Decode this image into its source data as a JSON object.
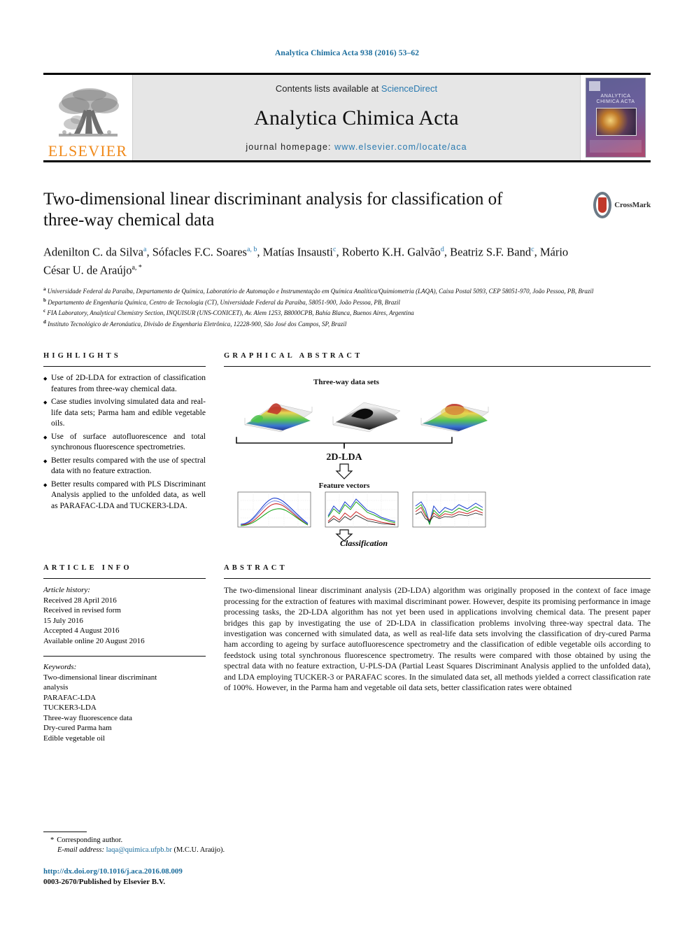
{
  "running_head": "Analytica Chimica Acta 938 (2016) 53–62",
  "masthead": {
    "publisher_name": "ELSEVIER",
    "contents_prefix": "Contents lists available at ",
    "contents_link": "ScienceDirect",
    "journal_title": "Analytica Chimica Acta",
    "homepage_prefix": "journal homepage: ",
    "homepage_url": "www.elsevier.com/locate/aca",
    "cover_title_line1": "ANALYTICA",
    "cover_title_line2": "CHIMICA ACTA"
  },
  "article": {
    "title": "Two-dimensional linear discriminant analysis for classification of three-way chemical data",
    "crossmark_label": "CrossMark",
    "authors_line1": "Adenilton C. da Silva",
    "authors": [
      {
        "name": "Adenilton C. da Silva",
        "marks": "a"
      },
      {
        "name": "Sófacles F.C. Soares",
        "marks": "a, b"
      },
      {
        "name": "Matías Insausti",
        "marks": "c"
      },
      {
        "name": "Roberto K.H. Galvão",
        "marks": "d"
      },
      {
        "name": "Beatriz S.F. Band",
        "marks": "c"
      },
      {
        "name": "Mário César U. de Araújo",
        "marks": "a, *"
      }
    ],
    "affiliations": [
      {
        "mark": "a",
        "text": "Universidade Federal da Paraíba, Departamento de Química, Laboratório de Automação e Instrumentação em Química Analítica/Quimiometria (LAQA), Caixa Postal 5093, CEP 58051-970, João Pessoa, PB, Brazil"
      },
      {
        "mark": "b",
        "text": "Departamento de Engenharia Química, Centro de Tecnologia (CT), Universidade Federal da Paraíba, 58051-900, João Pessoa, PB, Brazil"
      },
      {
        "mark": "c",
        "text": "FIA Laboratory, Analytical Chemistry Section, INQUISUR (UNS-CONICET), Av. Alem 1253, B8000CPB, Bahía Blanca, Buenos Aires, Argentina"
      },
      {
        "mark": "d",
        "text": "Instituto Tecnológico de Aeronáutica, Divisão de Engenharia Eletrônica, 12228-900, São José dos Campos, SP, Brazil"
      }
    ]
  },
  "highlights": {
    "heading": "HIGHLIGHTS",
    "items": [
      "Use of 2D-LDA for extraction of classification features from three-way chemical data.",
      "Case studies involving simulated data and real-life data sets; Parma ham and edible vegetable oils.",
      "Use of surface autofluorescence and total synchronous fluorescence spectrometries.",
      "Better results compared with the use of spectral data with no feature extraction.",
      "Better results compared with PLS Discriminant Analysis applied to the unfolded data, as well as PARAFAC-LDA and TUCKER3-LDA."
    ]
  },
  "article_info": {
    "heading": "ARTICLE INFO",
    "history_label": "Article history:",
    "history": [
      "Received 28 April 2016",
      "Received in revised form",
      "15 July 2016",
      "Accepted 4 August 2016",
      "Available online 20 August 2016"
    ],
    "keywords_label": "Keywords:",
    "keywords": [
      "Two-dimensional linear discriminant",
      "analysis",
      "PARAFAC-LDA",
      "TUCKER3-LDA",
      "Three-way fluorescence data",
      "Dry-cured Parma ham",
      "Edible vegetable oil"
    ]
  },
  "graphical_abstract": {
    "heading": "GRAPHICAL ABSTRACT",
    "caption_top": "Three-way data sets",
    "method_label": "2D-LDA",
    "caption_mid": "Feature vectors",
    "caption_bottom": "Classification"
  },
  "abstract": {
    "heading": "ABSTRACT",
    "text": "The two-dimensional linear discriminant analysis (2D-LDA) algorithm was originally proposed in the context of face image processing for the extraction of features with maximal discriminant power. However, despite its promising performance in image processing tasks, the 2D-LDA algorithm has not yet been used in applications involving chemical data. The present paper bridges this gap by investigating the use of 2D-LDA in classification problems involving three-way spectral data. The investigation was concerned with simulated data, as well as real-life data sets involving the classification of dry-cured Parma ham according to ageing by surface autofluorescence spectrometry and the classification of edible vegetable oils according to feedstock using total synchronous fluorescence spectrometry. The results were compared with those obtained by using the spectral data with no feature extraction, U-PLS-DA (Partial Least Squares Discriminant Analysis applied to the unfolded data), and LDA employing TUCKER-3 or PARAFAC scores. In the simulated data set, all methods yielded a correct classification rate of 100%. However, in the Parma ham and vegetable oil data sets, better classification rates were obtained"
  },
  "footer": {
    "corresponding_star": "*",
    "corresponding_label": "Corresponding author.",
    "email_label": "E-mail address:",
    "email": "laqa@quimica.ufpb.br",
    "email_suffix": "(M.C.U. Araújo).",
    "doi": "http://dx.doi.org/10.1016/j.aca.2016.08.009",
    "issn_line": "0003-2670/Published by Elsevier B.V."
  },
  "colors": {
    "link": "#1a6c9c",
    "accent": "#2a7ab0",
    "elsevier_orange": "#f08a1b",
    "masthead_bg": "#e6e6e6"
  }
}
